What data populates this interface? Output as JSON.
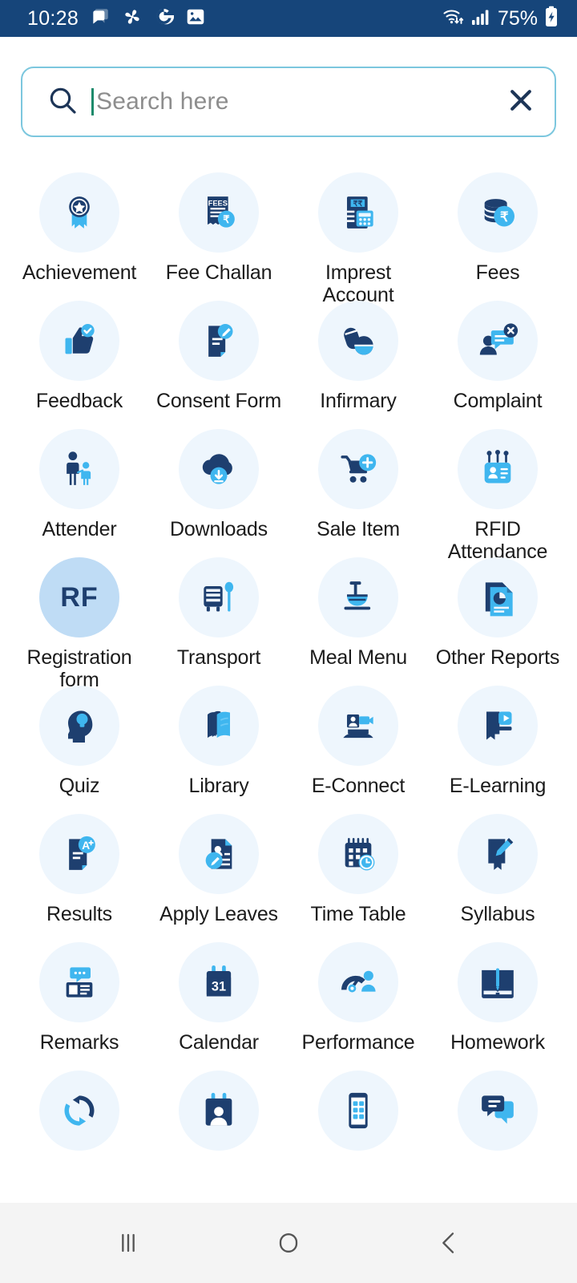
{
  "statusbar": {
    "time": "10:28",
    "battery_percent": "75%",
    "left_icons": [
      "chat-bubble-icon",
      "pinwheel-icon",
      "google-g-icon",
      "photo-icon"
    ],
    "right_icons": [
      "wifi-icon",
      "signal-bars-icon",
      "battery-charging-icon"
    ],
    "background_color": "#16457a"
  },
  "search": {
    "placeholder": "Search here",
    "value": "",
    "search_icon": "search-icon",
    "clear_icon": "close-icon",
    "border_color": "#7cc7de",
    "caret_color": "#1a8a6b"
  },
  "theme": {
    "bubble_bg": "#eef6fd",
    "bubble_bg_strong": "#bfdcf5",
    "icon_dark": "#1e3f6f",
    "icon_light": "#3fb6ef",
    "label_color": "#1b1b1b"
  },
  "grid": {
    "columns": 4,
    "items": [
      {
        "label": "Achievement",
        "icon": "achievement-medal-icon",
        "style": "normal"
      },
      {
        "label": "Fee Challan",
        "icon": "fee-challan-receipt-icon",
        "style": "normal"
      },
      {
        "label": "Imprest Account",
        "icon": "imprest-account-icon",
        "style": "normal"
      },
      {
        "label": "Fees",
        "icon": "fees-coins-icon",
        "style": "normal"
      },
      {
        "label": "Feedback",
        "icon": "thumbs-up-check-icon",
        "style": "normal"
      },
      {
        "label": "Consent Form",
        "icon": "consent-form-edit-icon",
        "style": "normal"
      },
      {
        "label": "Infirmary",
        "icon": "infirmary-pills-icon",
        "style": "normal"
      },
      {
        "label": "Complaint",
        "icon": "complaint-chat-close-icon",
        "style": "normal"
      },
      {
        "label": "Attender",
        "icon": "attender-parent-child-icon",
        "style": "normal"
      },
      {
        "label": "Downloads",
        "icon": "cloud-download-icon",
        "style": "normal"
      },
      {
        "label": "Sale Item",
        "icon": "sale-item-cart-plus-icon",
        "style": "normal"
      },
      {
        "label": "RFID Attendance",
        "icon": "rfid-card-icon",
        "style": "normal"
      },
      {
        "label": "Registration form",
        "icon": "rf-text-icon",
        "style": "strong",
        "icon_text": "RF"
      },
      {
        "label": "Transport",
        "icon": "transport-bus-icon",
        "style": "normal"
      },
      {
        "label": "Meal Menu",
        "icon": "meal-menu-icon",
        "style": "normal"
      },
      {
        "label": "Other Reports",
        "icon": "other-reports-chart-icon",
        "style": "normal"
      },
      {
        "label": "Quiz",
        "icon": "quiz-head-bulb-icon",
        "style": "normal"
      },
      {
        "label": "Library",
        "icon": "library-books-icon",
        "style": "normal"
      },
      {
        "label": "E-Connect",
        "icon": "e-connect-video-icon",
        "style": "normal"
      },
      {
        "label": "E-Learning",
        "icon": "e-learning-play-icon",
        "style": "normal"
      },
      {
        "label": "Results",
        "icon": "results-grade-icon",
        "style": "normal"
      },
      {
        "label": "Apply Leaves",
        "icon": "apply-leaves-icon",
        "style": "normal"
      },
      {
        "label": "Time Table",
        "icon": "time-table-calendar-icon",
        "style": "normal"
      },
      {
        "label": "Syllabus",
        "icon": "syllabus-book-pen-icon",
        "style": "normal"
      },
      {
        "label": "Remarks",
        "icon": "remarks-comment-icon",
        "style": "normal"
      },
      {
        "label": "Calendar",
        "icon": "calendar-31-icon",
        "style": "normal",
        "icon_text": "31"
      },
      {
        "label": "Performance",
        "icon": "performance-gauge-icon",
        "style": "normal"
      },
      {
        "label": "Homework",
        "icon": "homework-book-pencil-icon",
        "style": "normal"
      },
      {
        "label": "",
        "icon": "sync-refresh-icon",
        "style": "normal"
      },
      {
        "label": "",
        "icon": "attendance-calendar-icon",
        "style": "normal"
      },
      {
        "label": "",
        "icon": "mobile-app-icon",
        "style": "normal"
      },
      {
        "label": "",
        "icon": "messages-chat-icon",
        "style": "normal"
      }
    ]
  },
  "navbar": {
    "recents_icon": "recents-icon",
    "home_icon": "home-icon",
    "back_icon": "back-icon"
  }
}
